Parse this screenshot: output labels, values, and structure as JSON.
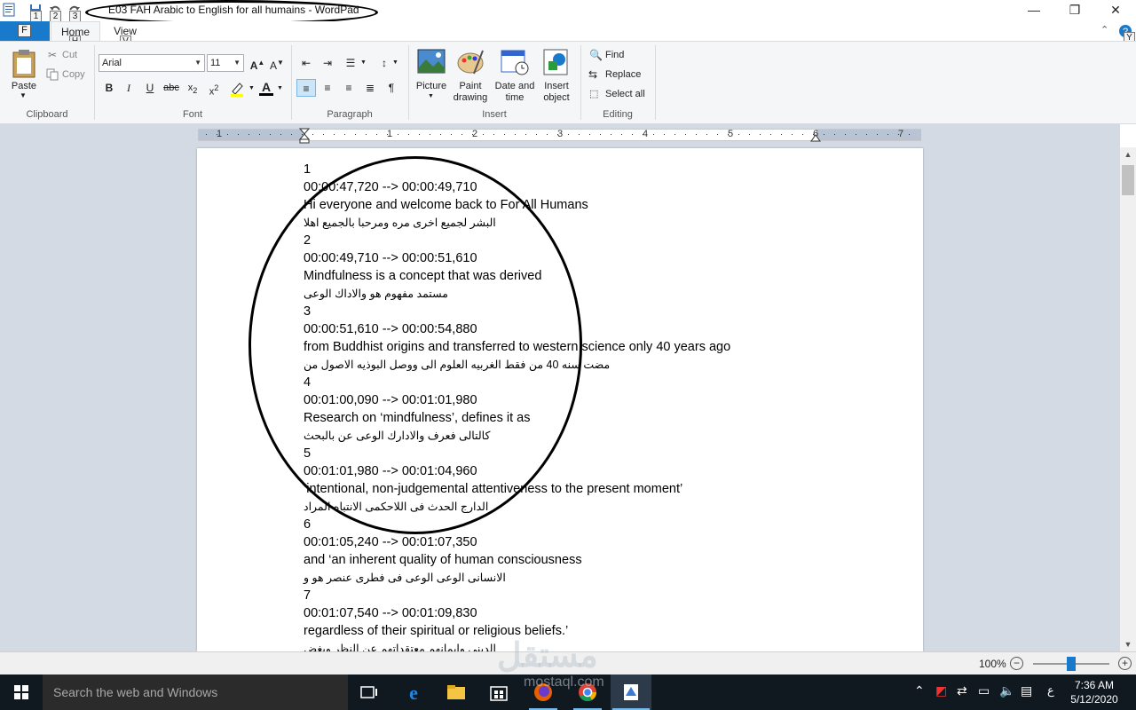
{
  "window": {
    "title": "E03 FAH Arabic to English for all humains - WordPad",
    "quick_access_tips": [
      "1",
      "2",
      "3"
    ],
    "minimize": "—",
    "restore": "❐",
    "close": "✕"
  },
  "tabs": {
    "file_tip": "F",
    "home": "Home",
    "home_tip": "H",
    "view": "View",
    "view_tip": "V",
    "help_tip": "Y"
  },
  "ribbon": {
    "clipboard": {
      "paste": "Paste",
      "cut": "Cut",
      "copy": "Copy",
      "label": "Clipboard"
    },
    "font": {
      "family": "Arial",
      "size": "11",
      "label": "Font"
    },
    "paragraph": {
      "label": "Paragraph"
    },
    "insert": {
      "picture": "Picture",
      "paint": "Paint\ndrawing",
      "datetime": "Date and\ntime",
      "object": "Insert\nobject",
      "label": "Insert"
    },
    "editing": {
      "find": "Find",
      "replace": "Replace",
      "select_all": "Select all",
      "label": "Editing"
    }
  },
  "ruler": {
    "numbers": [
      "1",
      "1",
      "2",
      "3",
      "4",
      "5",
      "6",
      "7"
    ]
  },
  "document": {
    "lines": [
      {
        "text": "1",
        "lang": "en"
      },
      {
        "text": "00:00:47,720 --> 00:00:49,710",
        "lang": "en"
      },
      {
        "text": "Hi everyone and welcome back to For All Humans",
        "lang": "en"
      },
      {
        "text": "البشر لجميع اخرى مره ومرحبا بالجميع اهلا",
        "lang": "ar"
      },
      {
        "text": "2",
        "lang": "en"
      },
      {
        "text": "00:00:49,710 --> 00:00:51,610",
        "lang": "en"
      },
      {
        "text": "Mindfulness is a concept that was derived",
        "lang": "en"
      },
      {
        "text": "مستمد مفهوم هو والاداك الوعى",
        "lang": "ar"
      },
      {
        "text": "3",
        "lang": "en"
      },
      {
        "text": "00:00:51,610 --> 00:00:54,880",
        "lang": "en"
      },
      {
        "text": "from Buddhist origins and transferred to western science only 40 years ago",
        "lang": "en"
      },
      {
        "text": "مضت سنه 40 من فقط الغربيه العلوم الى ووصل البوذيه الاصول من",
        "lang": "ar"
      },
      {
        "text": "4",
        "lang": "en"
      },
      {
        "text": "00:01:00,090 --> 00:01:01,980",
        "lang": "en"
      },
      {
        "text": "Research on ‘mindfulness’, defines it as",
        "lang": "en"
      },
      {
        "text": "كالتالى فعرف والادارك الوعى عن بالبحث",
        "lang": "ar"
      },
      {
        "text": "5",
        "lang": "en"
      },
      {
        "text": "00:01:01,980 --> 00:01:04,960",
        "lang": "en"
      },
      {
        "text": "‘intentional, non-judgemental attentiveness to the present moment’",
        "lang": "en"
      },
      {
        "text": "الدارج الحدث فى اللاحكمى الانتباه المراد",
        "lang": "ar"
      },
      {
        "text": "6",
        "lang": "en"
      },
      {
        "text": "00:01:05,240 --> 00:01:07,350",
        "lang": "en"
      },
      {
        "text": "and ‘an inherent quality of human consciousness",
        "lang": "en"
      },
      {
        "text": "الانسانى الوعى الوعى فى فطرى عنصر هو و",
        "lang": "ar"
      },
      {
        "text": "7",
        "lang": "en"
      },
      {
        "text": "00:01:07,540 --> 00:01:09,830",
        "lang": "en"
      },
      {
        "text": "regardless of their spiritual or religious beliefs.’",
        "lang": "en"
      },
      {
        "text": "الدينى وايمانهم معتقداتهم عن النظر وبغض",
        "lang": "ar"
      }
    ]
  },
  "status": {
    "zoom": "100%",
    "zoom_minus": "−",
    "zoom_plus": "+",
    "zoom_level_percent": 100
  },
  "taskbar": {
    "search_placeholder": "Search the web and Windows",
    "time": "7:36 AM",
    "date": "5/12/2020",
    "ime": "ع"
  },
  "watermark": {
    "arabic": "مستقل",
    "latin": "mostaql.com"
  },
  "colors": {
    "accent": "#1979ca",
    "ribbon_bg": "#f5f6f7",
    "doc_bg": "#d4dae4",
    "taskbar_bg": "#101820"
  }
}
